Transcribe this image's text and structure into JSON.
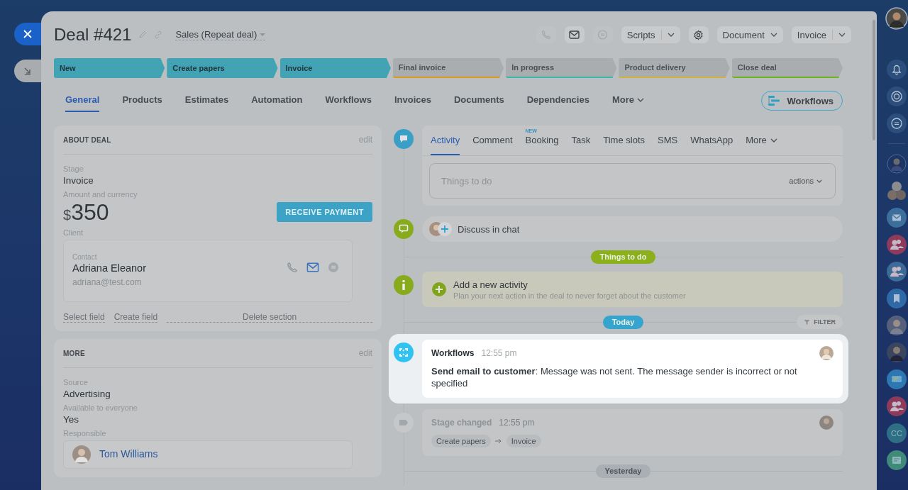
{
  "header": {
    "title": "Deal #421",
    "pipeline": "Sales (Repeat deal)"
  },
  "toolbar": {
    "contact_buttons": [
      {
        "kind": "phone",
        "disabled": true
      },
      {
        "kind": "mail",
        "disabled": false
      },
      {
        "kind": "chat",
        "disabled": true
      }
    ],
    "scripts": "Scripts",
    "document": "Document",
    "invoice": "Invoice"
  },
  "stages": [
    {
      "label": "New",
      "done": true,
      "color": "#42a3b4"
    },
    {
      "label": "Create papers",
      "done": true,
      "color": "#42a3b4"
    },
    {
      "label": "Invoice",
      "done": true,
      "color": "#42a3b4"
    },
    {
      "label": "Final invoice",
      "done": false,
      "color": "#dc9a1c"
    },
    {
      "label": "In progress",
      "done": false,
      "color": "#3bb7ae"
    },
    {
      "label": "Product delivery",
      "done": false,
      "color": "#cfb13e"
    },
    {
      "label": "Close deal",
      "done": false,
      "color": "#6db51f"
    }
  ],
  "tabs": [
    {
      "label": "General",
      "selected": true
    },
    {
      "label": "Products",
      "selected": false
    },
    {
      "label": "Estimates",
      "selected": false
    },
    {
      "label": "Automation",
      "selected": false
    },
    {
      "label": "Workflows",
      "selected": false
    },
    {
      "label": "Invoices",
      "selected": false
    },
    {
      "label": "Documents",
      "selected": false
    },
    {
      "label": "Dependencies",
      "selected": false
    }
  ],
  "tabs_more": "More",
  "workflows_button": "Workflows",
  "about_deal": {
    "title": "ABOUT DEAL",
    "edit": "edit",
    "stage_label": "Stage",
    "stage": "Invoice",
    "amount_label": "Amount and currency",
    "currency": "$",
    "amount": "350",
    "payment_button": "RECEIVE PAYMENT",
    "client_label": "Client",
    "contact": {
      "label": "Contact",
      "name": "Adriana Eleanor",
      "email": "adriana@test.com"
    },
    "links": [
      "Select field",
      "Create field"
    ],
    "delete": "Delete section"
  },
  "more_section": {
    "title": "MORE",
    "edit": "edit",
    "fields": [
      {
        "label": "Source",
        "value": "Advertising"
      },
      {
        "label": "Available to everyone",
        "value": "Yes"
      }
    ],
    "responsible_label": "Responsible",
    "responsible": "Tom Williams"
  },
  "composer": {
    "tabs": [
      {
        "label": "Activity",
        "selected": true
      },
      {
        "label": "Comment",
        "selected": false
      },
      {
        "label": "Booking",
        "selected": false,
        "badge": "NEW"
      },
      {
        "label": "Task",
        "selected": false
      },
      {
        "label": "Time slots",
        "selected": false
      },
      {
        "label": "SMS",
        "selected": false
      },
      {
        "label": "WhatsApp",
        "selected": false
      }
    ],
    "more": "More",
    "placeholder": "Things to do",
    "actions": "actions"
  },
  "timeline": [
    {
      "kind": "chat",
      "highlighted": false,
      "text": "Discuss in chat"
    },
    {
      "kind": "divider",
      "label": "Things to do",
      "color": "#8cb01b"
    },
    {
      "kind": "activity",
      "highlighted": false,
      "title": "Add a new activity",
      "text": "Plan your next action in the deal to never forget about the customer"
    },
    {
      "kind": "divider",
      "label": "Today",
      "color": "#35a5cf",
      "filter": "FILTER"
    },
    {
      "kind": "workflow",
      "highlighted": true,
      "title": "Workflows",
      "time": "12:55 pm",
      "text": "**Send email to customer**: Message was not sent. The message sender is incorrect or not specified"
    },
    {
      "kind": "stage",
      "highlighted": false,
      "title": "Stage changed",
      "time": "12:55 pm",
      "from": "Create papers",
      "to": "Invoice"
    },
    {
      "kind": "divider",
      "label": "Yesterday",
      "color": "#a9afb3"
    }
  ],
  "right_bar": {
    "initials": "CC"
  }
}
